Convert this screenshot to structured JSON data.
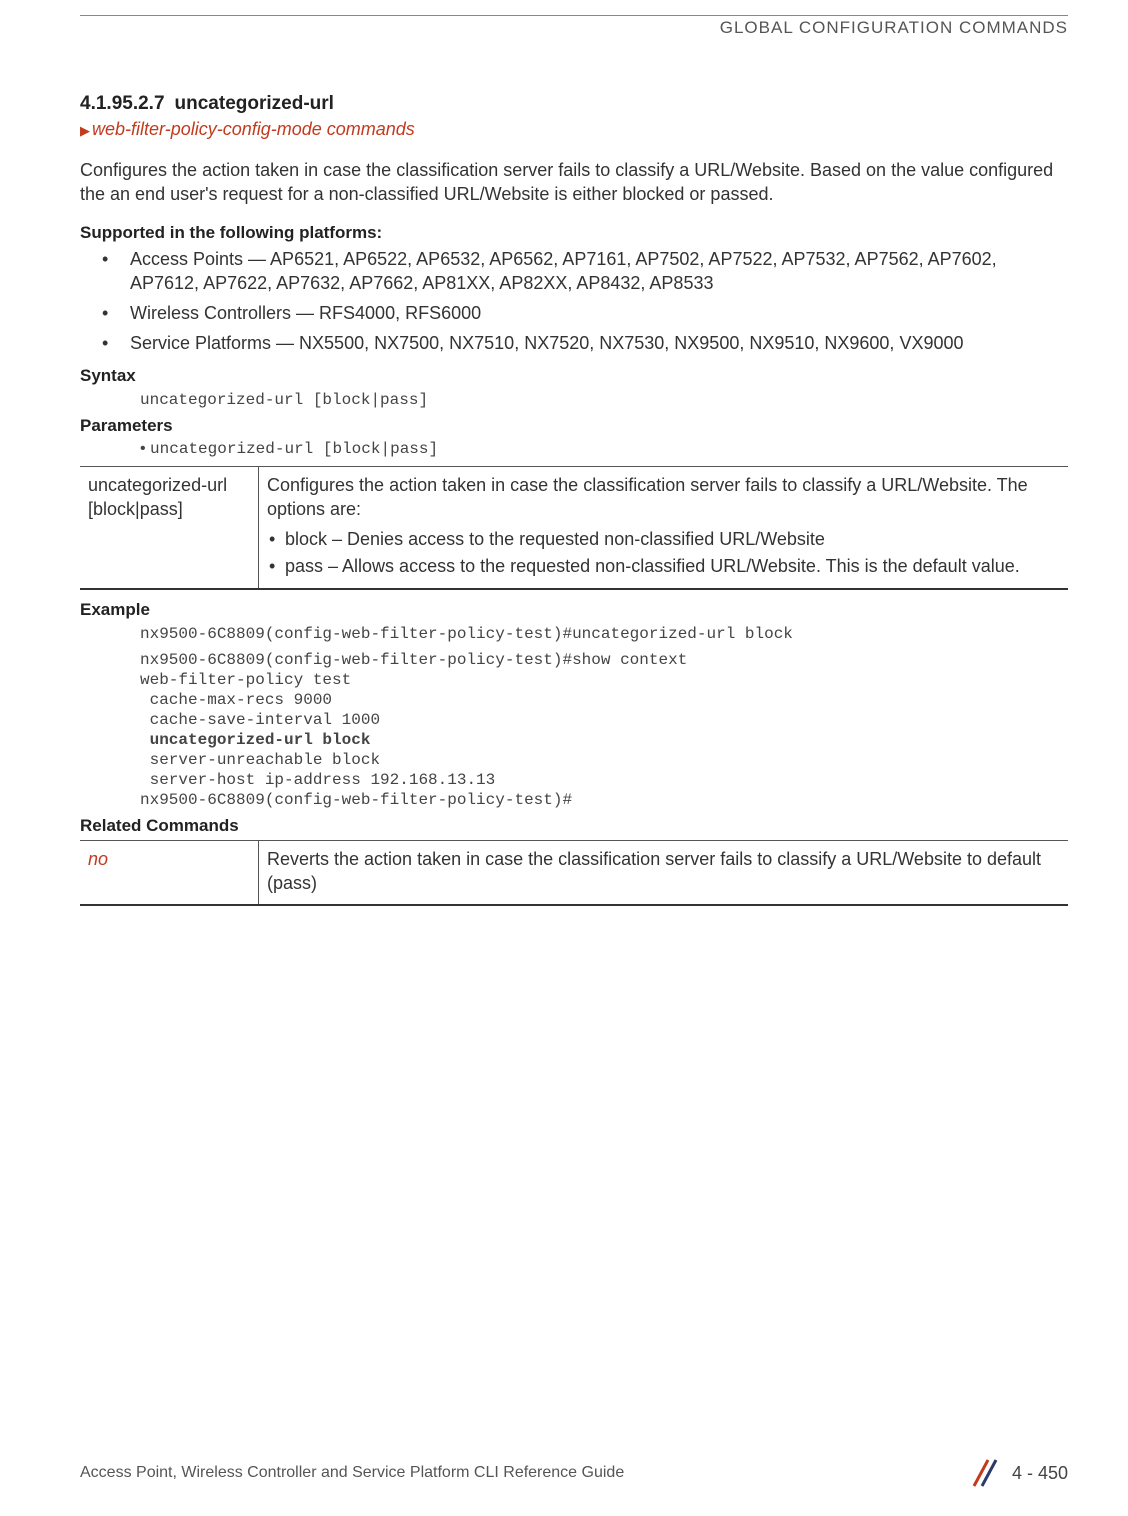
{
  "header": {
    "category": "GLOBAL CONFIGURATION COMMANDS"
  },
  "section": {
    "number": "4.1.95.2.7",
    "title": "uncategorized-url",
    "breadcrumb": "web-filter-policy-config-mode commands",
    "intro": "Configures the action taken in case the classification server fails to classify a URL/Website. Based on the value configured the an end user's request for a non-classified URL/Website is either blocked or passed."
  },
  "supported": {
    "heading": "Supported in the following platforms:",
    "items": [
      "Access Points — AP6521, AP6522, AP6532, AP6562, AP7161, AP7502, AP7522, AP7532, AP7562, AP7602, AP7612, AP7622, AP7632, AP7662, AP81XX, AP82XX, AP8432, AP8533",
      "Wireless Controllers — RFS4000, RFS6000",
      "Service Platforms — NX5500, NX7500, NX7510, NX7520, NX7530, NX9500, NX9510, NX9600, VX9000"
    ]
  },
  "syntax": {
    "heading": "Syntax",
    "code": "uncategorized-url [block|pass]"
  },
  "parameters": {
    "heading": "Parameters",
    "bullet": "uncategorized-url [block|pass]",
    "table": {
      "left": "uncategorized-url [block|pass]",
      "right_intro": "Configures the action taken in case the classification server fails to classify a URL/Website. The options are:",
      "options": [
        "block – Denies access to the requested non-classified URL/Website",
        "pass – Allows access to the requested non-classified URL/Website. This is the default value."
      ]
    }
  },
  "example": {
    "heading": "Example",
    "line1": "nx9500-6C8809(config-web-filter-policy-test)#uncategorized-url block",
    "block_pre": "nx9500-6C8809(config-web-filter-policy-test)#show context\nweb-filter-policy test\n cache-max-recs 9000\n cache-save-interval 1000",
    "block_bold": " uncategorized-url block",
    "block_post": " server-unreachable block\n server-host ip-address 192.168.13.13\nnx9500-6C8809(config-web-filter-policy-test)#"
  },
  "related": {
    "heading": "Related Commands",
    "left": "no",
    "right": "Reverts the action taken in case the classification server fails to classify a URL/Website to default (pass)"
  },
  "footer": {
    "guide": "Access Point, Wireless Controller and Service Platform CLI Reference Guide",
    "page": "4 - 450"
  }
}
